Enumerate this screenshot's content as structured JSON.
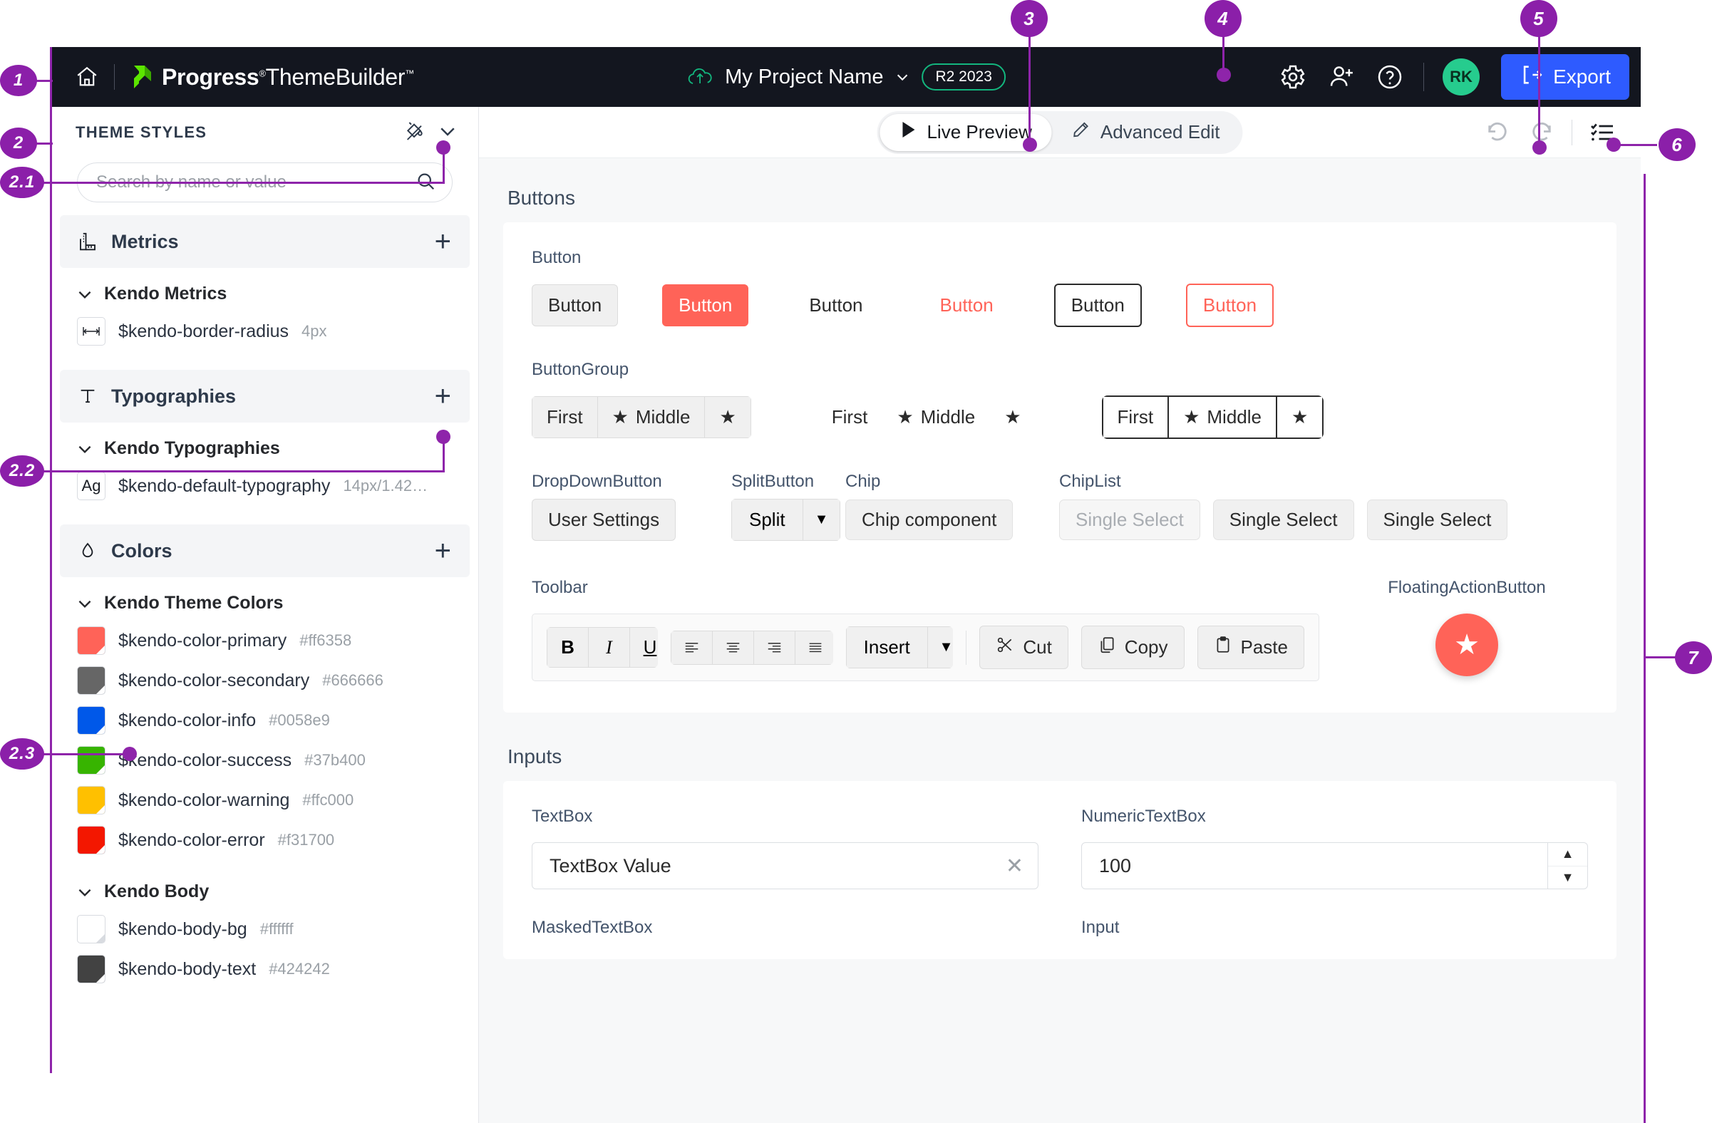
{
  "header": {
    "home_icon": "home-icon",
    "brand_bold": "Progress",
    "brand_reg": "ThemeBuilder",
    "brand_sup_reg": "®",
    "brand_sup_tm": "™",
    "project_name": "My Project Name",
    "version_badge": "R2 2023",
    "gear_icon": "gear-icon",
    "add_user_icon": "add-user-icon",
    "help_icon": "help-icon",
    "avatar_initials": "RK",
    "export_label": "Export",
    "export_color": "#2e5bff",
    "avatar_color": "#26cc8e",
    "bar_color": "#13161f"
  },
  "sidebar": {
    "title": "THEME STYLES",
    "paint_icon": "paint-bucket-icon",
    "collapse_icon": "chevron-down-icon",
    "search": {
      "placeholder": "Search by name or value",
      "value": "",
      "icon": "search-icon"
    },
    "groups": [
      {
        "name": "Metrics",
        "icon": "ruler-icon",
        "add_label": "+",
        "subgroups": [
          {
            "name": "Kendo Metrics",
            "tokens": [
              {
                "swatch_type": "icon",
                "icon": "width-arrows-icon",
                "name": "$kendo-border-radius",
                "value": "4px"
              }
            ]
          }
        ]
      },
      {
        "name": "Typographies",
        "icon": "text-t-icon",
        "add_label": "+",
        "subgroups": [
          {
            "name": "Kendo Typographies",
            "tokens": [
              {
                "swatch_type": "text",
                "icon": "Ag",
                "name": "$kendo-default-typography",
                "value": "14px/1.42…"
              }
            ]
          }
        ]
      },
      {
        "name": "Colors",
        "icon": "droplet-icon",
        "add_label": "+",
        "subgroups": [
          {
            "name": "Kendo Theme Colors",
            "tokens": [
              {
                "swatch_type": "color",
                "color": "#ff6358",
                "name": "$kendo-color-primary",
                "value": "#ff6358"
              },
              {
                "swatch_type": "color",
                "color": "#666666",
                "name": "$kendo-color-secondary",
                "value": "#666666"
              },
              {
                "swatch_type": "color",
                "color": "#0058e9",
                "name": "$kendo-color-info",
                "value": "#0058e9"
              },
              {
                "swatch_type": "color",
                "color": "#37b400",
                "name": "$kendo-color-success",
                "value": "#37b400"
              },
              {
                "swatch_type": "color",
                "color": "#ffc000",
                "name": "$kendo-color-warning",
                "value": "#ffc000"
              },
              {
                "swatch_type": "color",
                "color": "#f31700",
                "name": "$kendo-color-error",
                "value": "#f31700"
              }
            ]
          },
          {
            "name": "Kendo Body",
            "tokens": [
              {
                "swatch_type": "color",
                "color": "#ffffff",
                "name": "$kendo-body-bg",
                "value": "#ffffff"
              },
              {
                "swatch_type": "color",
                "color": "#424242",
                "name": "$kendo-body-text",
                "value": "#424242"
              }
            ]
          }
        ]
      }
    ]
  },
  "toolbar": {
    "live_preview": "Live Preview",
    "advanced_edit": "Advanced Edit",
    "play_icon": "play-icon",
    "pencil_icon": "pencil-icon",
    "undo_icon": "undo-icon",
    "redo_icon": "redo-icon",
    "checklist_icon": "checklist-icon"
  },
  "preview": {
    "sections": [
      {
        "title": "Buttons"
      },
      {
        "title": "Inputs"
      }
    ],
    "buttons": {
      "label": "Button",
      "items": [
        {
          "text": "Button",
          "variant": "base"
        },
        {
          "text": "Button",
          "variant": "primary"
        },
        {
          "text": "Button",
          "variant": "flat"
        },
        {
          "text": "Button",
          "variant": "flat-primary"
        },
        {
          "text": "Button",
          "variant": "outline"
        },
        {
          "text": "Button",
          "variant": "outline-primary"
        }
      ]
    },
    "buttongroup": {
      "label": "ButtonGroup",
      "first": "First",
      "middle": "Middle",
      "star_icon": "star-icon"
    },
    "dropdownbutton": {
      "label": "DropDownButton",
      "text": "User Settings"
    },
    "splitbutton": {
      "label": "SplitButton",
      "text": "Split",
      "arrow": "▼"
    },
    "chip": {
      "label": "Chip",
      "text": "Chip component"
    },
    "chiplist": {
      "label": "ChipList",
      "items": [
        "Single Select",
        "Single Select",
        "Single Select"
      ]
    },
    "toolbarwidget": {
      "label": "Toolbar",
      "bold": "B",
      "italic": "I",
      "underline": "U",
      "align_left_icon": "align-left-icon",
      "align_center_icon": "align-center-icon",
      "align_right_icon": "align-right-icon",
      "align_justify_icon": "align-justify-icon",
      "insert": "Insert",
      "insert_arrow": "▼",
      "cut": "Cut",
      "copy": "Copy",
      "paste": "Paste",
      "cut_icon": "scissors-icon",
      "copy_icon": "copy-icon",
      "paste_icon": "clipboard-icon"
    },
    "fab": {
      "label": "FloatingActionButton",
      "icon": "star-icon",
      "color": "#ff6358"
    },
    "inputs": {
      "textbox": {
        "label": "TextBox",
        "value": "TextBox Value",
        "clear": "✕"
      },
      "numerictextbox": {
        "label": "NumericTextBox",
        "value": "100"
      },
      "maskedtextbox": {
        "label": "MaskedTextBox"
      },
      "input": {
        "label": "Input"
      }
    }
  },
  "callouts": {
    "color": "#8b1fa9",
    "items": [
      "1",
      "2",
      "2.1",
      "2.2",
      "2.3",
      "3",
      "4",
      "5",
      "6",
      "7"
    ]
  }
}
